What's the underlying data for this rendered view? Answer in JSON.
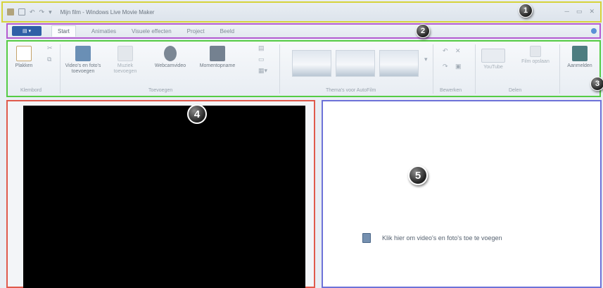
{
  "titlebar": {
    "title": "Mijn film - Windows Live Movie Maker",
    "qat_icons": [
      "film-icon",
      "save-icon",
      "undo-icon",
      "redo-icon",
      "qat-dropdown-icon"
    ],
    "window_buttons": [
      "minimize",
      "maximize",
      "close"
    ]
  },
  "tabs": {
    "items": [
      "Start",
      "Animaties",
      "Visuele effecten",
      "Project",
      "Beeld"
    ],
    "active": "Start"
  },
  "ribbon": {
    "clipboard": {
      "paste": "Plakken",
      "group": "Klembord"
    },
    "add": {
      "add_video": "Video's en foto's toevoegen",
      "add_music": "Muziek toevoegen",
      "webcam": "Webcamvideo",
      "snapshot": "Momentopname",
      "group": "Toevoegen"
    },
    "themes": {
      "group": "Thema's voor AutoFilm"
    },
    "edit": {
      "group": "Bewerken"
    },
    "share": {
      "youtube": "YouTube",
      "share_label": "Film opslaan",
      "group": "Delen"
    },
    "save": {
      "label": "Aanmelden"
    }
  },
  "storyboard": {
    "hint": "Klik hier om video's en foto's toe te voegen"
  },
  "callouts": [
    "1",
    "2",
    "3",
    "4",
    "5"
  ]
}
